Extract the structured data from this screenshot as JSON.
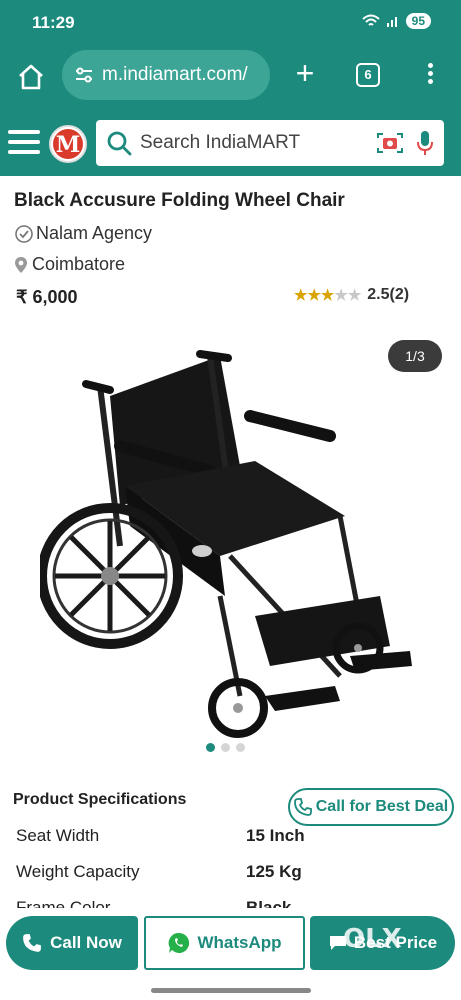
{
  "status_bar": {
    "time": "11:29",
    "battery": "95"
  },
  "browser": {
    "url": "m.indiamart.com/",
    "tab_count": "6"
  },
  "header": {
    "logo_letter": "M",
    "search_placeholder": "Search IndiaMART"
  },
  "product": {
    "title": "Black Accusure Folding Wheel Chair",
    "seller": "Nalam Agency",
    "location": "Coimbatore",
    "price": "₹ 6,000",
    "rating_value": 2.5,
    "rating_text": "2.5(2)",
    "image_counter": "1/3",
    "image_slides": 3,
    "active_slide": 1
  },
  "specifications": {
    "title": "Product Specifications",
    "call_button": "Call for Best Deal",
    "rows": [
      {
        "label": "Seat Width",
        "value": "15 Inch"
      },
      {
        "label": "Weight Capacity",
        "value": "125 Kg"
      },
      {
        "label": "Frame Color",
        "value": "Black"
      }
    ]
  },
  "actions": {
    "call_now": "Call Now",
    "whatsapp": "WhatsApp",
    "best_price": "Best Price"
  },
  "overlay": {
    "watermark": "OLX"
  },
  "colors": {
    "brand": "#1c8a7c",
    "star": "#d9a400"
  }
}
